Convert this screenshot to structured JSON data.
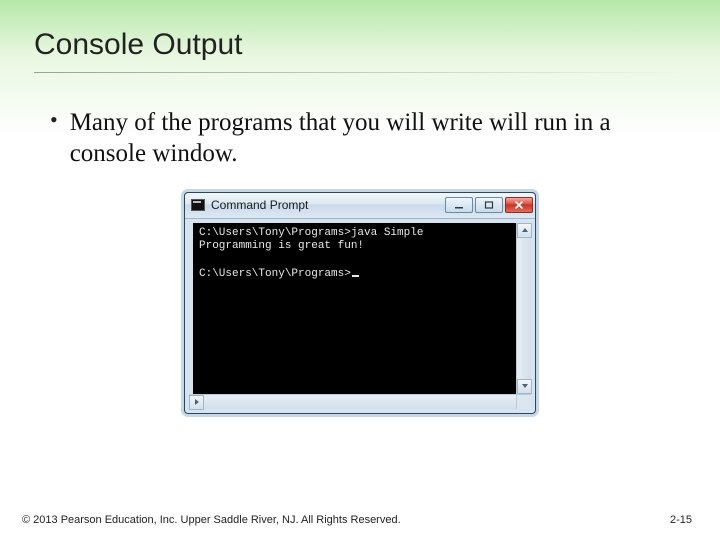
{
  "title": "Console Output",
  "bullet": "Many of the programs that you will write will run in a console window.",
  "window": {
    "title": "Command Prompt",
    "lines": [
      "C:\\Users\\Tony\\Programs>java Simple",
      "Programming is great fun!",
      "",
      "C:\\Users\\Tony\\Programs>"
    ]
  },
  "footer": {
    "copyright": "© 2013 Pearson Education, Inc. Upper Saddle River, NJ. All Rights Reserved.",
    "page": "2-15"
  }
}
